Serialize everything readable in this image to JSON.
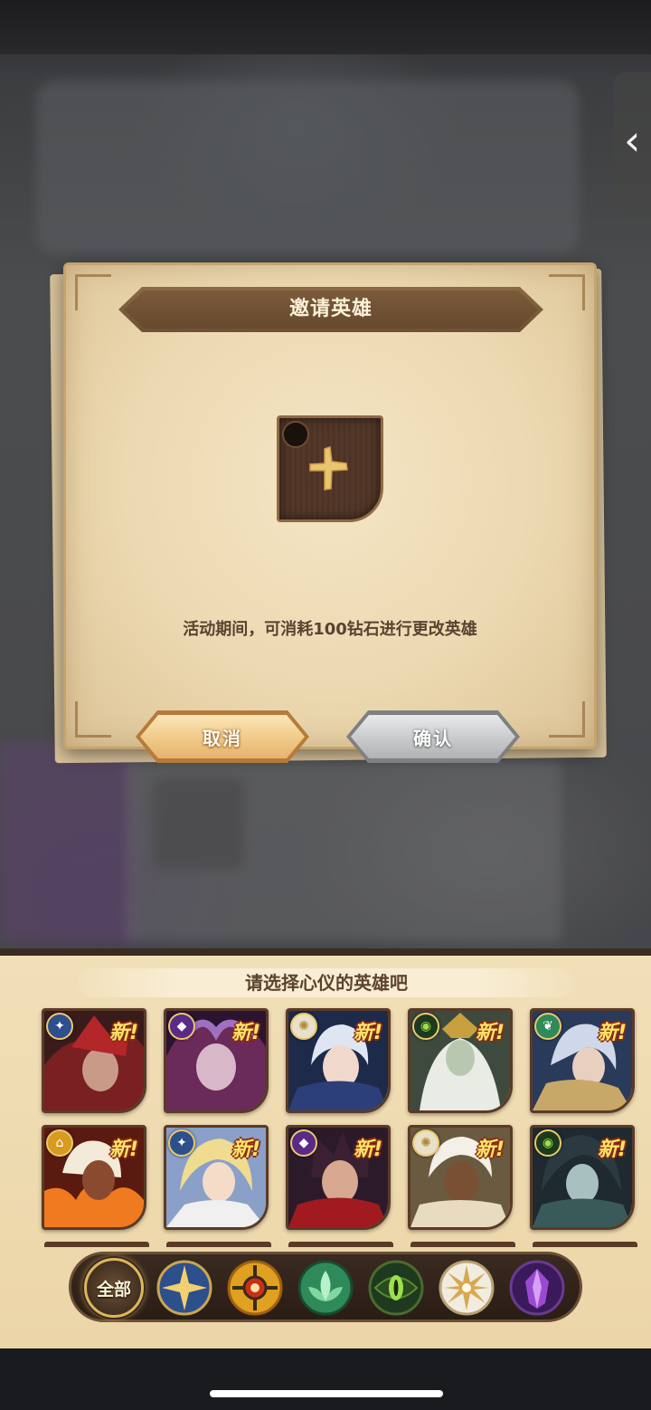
{
  "dialog": {
    "title": "邀请英雄",
    "message": "活动期间，可消耗100钻石进行更改英雄",
    "cancel_label": "取消",
    "confirm_label": "确认",
    "slot_icon": "plus-icon"
  },
  "panel": {
    "title": "请选择心仪的英雄吧",
    "heroes": [
      {
        "faction": "lightbearer",
        "new_label": "新!"
      },
      {
        "faction": "graveborn",
        "new_label": "新!"
      },
      {
        "faction": "celestial",
        "new_label": "新!"
      },
      {
        "faction": "wilder",
        "new_label": "新!"
      },
      {
        "faction": "wilder",
        "new_label": "新!"
      },
      {
        "faction": "mauler",
        "new_label": "新!"
      },
      {
        "faction": "lightbearer",
        "new_label": "新!"
      },
      {
        "faction": "graveborn",
        "new_label": "新!"
      },
      {
        "faction": "celestial",
        "new_label": "新!"
      },
      {
        "faction": "wilder",
        "new_label": "新!"
      }
    ],
    "filters": [
      {
        "name": "all",
        "label": "全部",
        "selected": true
      },
      {
        "name": "lightbearer",
        "icon": "star-compass-icon"
      },
      {
        "name": "mauler",
        "icon": "flame-shield-icon"
      },
      {
        "name": "wilder",
        "icon": "leaf-icon"
      },
      {
        "name": "graveborn",
        "icon": "eye-icon"
      },
      {
        "name": "celestial",
        "icon": "sun-star-icon"
      },
      {
        "name": "hypogean",
        "icon": "crystal-icon"
      }
    ]
  },
  "colors": {
    "parchment": "#ecd9b1",
    "banner": "#6e5133",
    "cancel_button": "#f0c987",
    "confirm_button": "#c8cacc",
    "new_tag": "#ffe56b",
    "new_tag_outline": "#8b2c10"
  }
}
